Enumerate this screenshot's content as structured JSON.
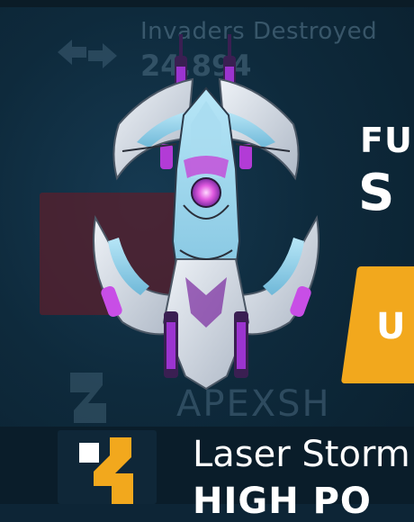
{
  "hud": {
    "stat_label": "Invaders Destroyed",
    "stat_value": "24,894"
  },
  "promo": {
    "line1": "FU",
    "line2": "S",
    "button_label": "U"
  },
  "background": {
    "faded_caption": "APEXSH"
  },
  "perk": {
    "name": "Laser Storm",
    "tier": "HIGH PO"
  },
  "colors": {
    "accent": "#f2a81d",
    "ship_purple": "#b23bd6",
    "ship_cyan": "#8fd3ee",
    "ship_silver": "#d9e0ea",
    "background": "#0d2536"
  },
  "icons": {
    "perk_icon": "laser-storm-icon",
    "bg_arrow": "swap-arrows-icon"
  }
}
